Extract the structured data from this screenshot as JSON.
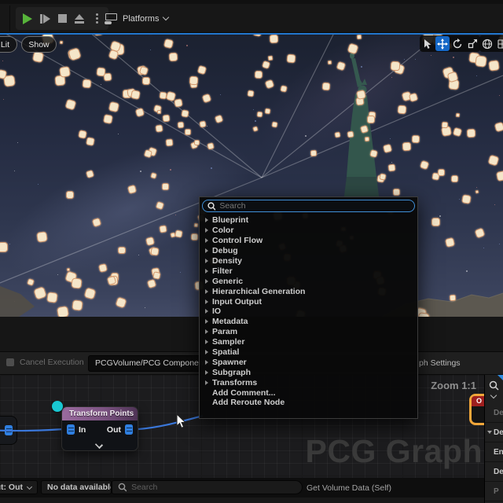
{
  "top_toolbar": {
    "platforms_label": "Platforms",
    "buttons": [
      "play",
      "frame-skip",
      "stop",
      "eject",
      "more-options"
    ]
  },
  "viewport": {
    "lit_label": "Lit",
    "show_label": "Show",
    "toolbar_icons": [
      "select",
      "move",
      "rotate",
      "scale",
      "world",
      "snap"
    ],
    "active_tool": "move"
  },
  "context_menu": {
    "search_placeholder": "Search",
    "categories": [
      "Blueprint",
      "Color",
      "Control Flow",
      "Debug",
      "Density",
      "Filter",
      "Generic",
      "Hierarchical Generation",
      "Input Output",
      "IO",
      "Metadata",
      "Param",
      "Sampler",
      "Spatial",
      "Spawner",
      "Subgraph",
      "Transforms"
    ],
    "actions": [
      "Add Comment...",
      "Add Reroute Node"
    ]
  },
  "execution_bar": {
    "cancel_label": "Cancel Execution",
    "path_value": "PCGVolume/PCG Component/NewP",
    "settings_label": "ph Settings"
  },
  "graph": {
    "zoom_label": "Zoom 1:1",
    "watermark": "PCG Graph",
    "transform_node": {
      "title": "Transform Points",
      "in_label": "In",
      "out_label": "Out"
    },
    "clipped_node_label": "O"
  },
  "details_panel": {
    "rows": [
      {
        "label": "De",
        "dim": true,
        "arrow": false
      },
      {
        "label": "De",
        "dim": false,
        "arrow": true
      },
      {
        "label": "En",
        "dim": false,
        "arrow": false
      },
      {
        "label": "De",
        "dim": false,
        "arrow": false
      },
      {
        "label": "P",
        "dim": true,
        "arrow": false
      }
    ]
  },
  "bottom_bar": {
    "output_dropdown": "ut: Out",
    "data_dropdown": "No data available",
    "search_placeholder": "Search",
    "status_text": "Get Volume Data (Self)"
  },
  "colors": {
    "accent_blue": "#2276cc",
    "node_header_purple": "#8f5f95",
    "wire_blue": "#3a77d9",
    "point_fill": "#f5e6c9",
    "point_border": "#cd8c5f",
    "selection_orange": "#f0a63a",
    "inspect_cyan": "#19c8d2",
    "red_node_header": "#9e1f1f"
  }
}
